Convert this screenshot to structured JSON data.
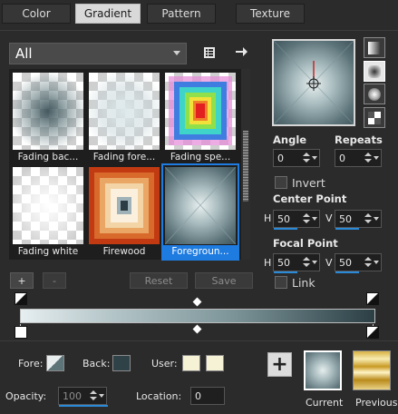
{
  "tabs": [
    {
      "label": "Color"
    },
    {
      "label": "Gradient"
    },
    {
      "label": "Pattern"
    },
    {
      "label": "Texture"
    }
  ],
  "category": {
    "selected": "All"
  },
  "gradients": [
    {
      "name": "Fading bac..."
    },
    {
      "name": "Fading fore..."
    },
    {
      "name": "Fading spe..."
    },
    {
      "name": "Fading white"
    },
    {
      "name": "Firewood"
    },
    {
      "name": "Foregroun..."
    }
  ],
  "settings": {
    "angle_label": "Angle",
    "angle_value": "0",
    "repeats_label": "Repeats",
    "repeats_value": "0",
    "invert_label": "Invert",
    "center_label": "Center Point",
    "center_h_label": "H",
    "center_h": "50",
    "center_v_label": "V",
    "center_v": "50",
    "focal_label": "Focal Point",
    "focal_h_label": "H",
    "focal_h": "50",
    "focal_v_label": "V",
    "focal_v": "50",
    "link_label": "Link"
  },
  "editor": {
    "add_label": "+",
    "remove_label": "-",
    "reset_label": "Reset",
    "save_label": "Save"
  },
  "bottom": {
    "fore_label": "Fore:",
    "back_label": "Back:",
    "user_label": "User:",
    "opacity_label": "Opacity:",
    "opacity_value": "100",
    "location_label": "Location:",
    "location_value": "0",
    "current_label": "Current",
    "previous_label": "Previous",
    "plus_label": "+"
  },
  "colors": {
    "accent": "#1e7be0",
    "panel_bg": "#2b2b2b"
  }
}
